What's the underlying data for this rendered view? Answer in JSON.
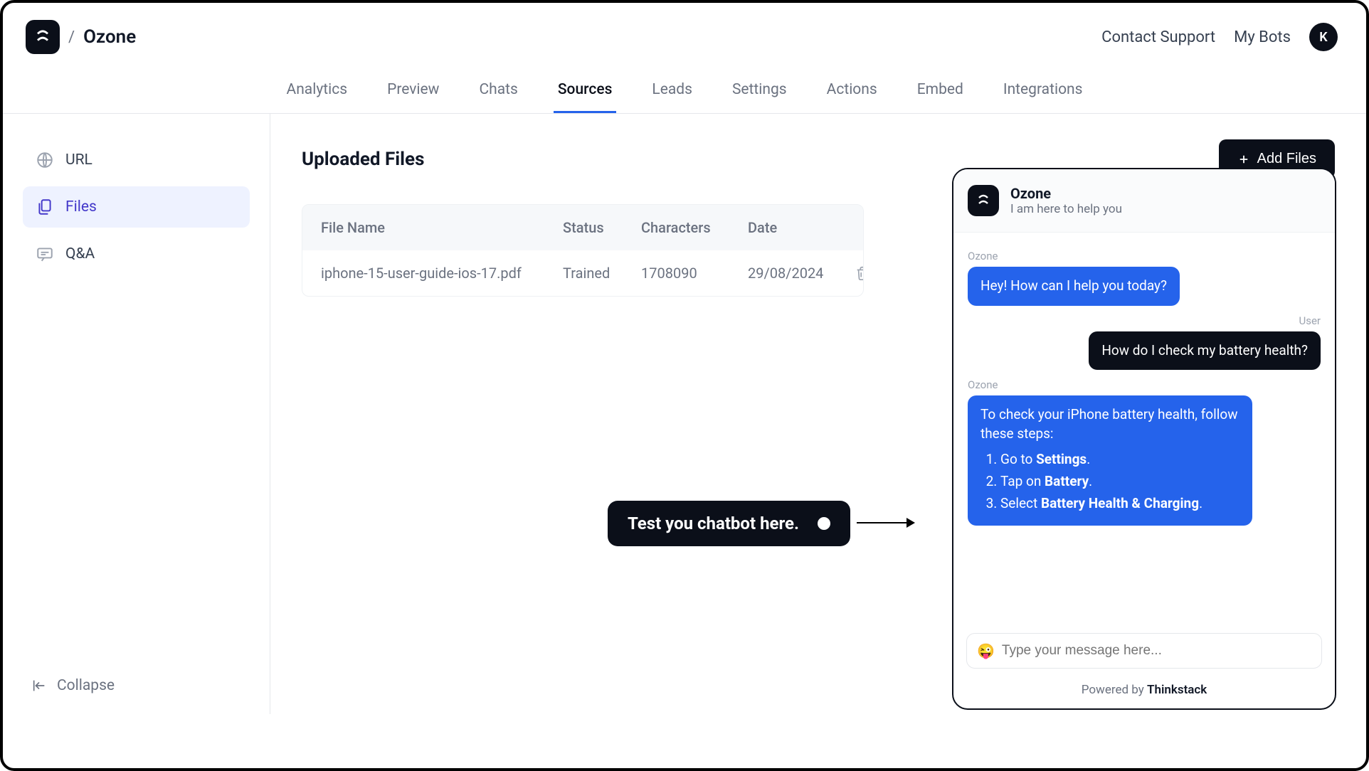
{
  "breadcrumb": {
    "title": "Ozone",
    "sep": "/"
  },
  "header_links": {
    "support": "Contact Support",
    "mybots": "My Bots",
    "avatar": "K"
  },
  "tabs": [
    {
      "label": "Analytics"
    },
    {
      "label": "Preview"
    },
    {
      "label": "Chats"
    },
    {
      "label": "Sources"
    },
    {
      "label": "Leads"
    },
    {
      "label": "Settings"
    },
    {
      "label": "Actions"
    },
    {
      "label": "Embed"
    },
    {
      "label": "Integrations"
    }
  ],
  "active_tab_index": 3,
  "sidebar": {
    "items": [
      {
        "label": "URL"
      },
      {
        "label": "Files"
      },
      {
        "label": "Q&A"
      }
    ],
    "active_index": 1,
    "collapse": "Collapse"
  },
  "main": {
    "title": "Uploaded Files",
    "add_label": "Add Files",
    "columns": {
      "name": "File Name",
      "status": "Status",
      "chars": "Characters",
      "date": "Date"
    },
    "rows": [
      {
        "name": "iphone-15-user-guide-ios-17.pdf",
        "status": "Trained",
        "chars": "1708090",
        "date": "29/08/2024"
      }
    ]
  },
  "callout": {
    "text": "Test you chatbot here."
  },
  "chat": {
    "header": {
      "title": "Ozone",
      "subtitle": "I am here to help you"
    },
    "messages": {
      "s0": "Ozone",
      "m0": "Hey! How can I help you today?",
      "s1": "User",
      "m1": "How do I check my battery health?",
      "s2": "Ozone",
      "m2_intro": "To check your iPhone battery health, follow these steps:",
      "m2_step1_a": "Go to ",
      "m2_step1_b": "Settings",
      "m2_step1_c": ".",
      "m2_step2_a": "Tap on ",
      "m2_step2_b": "Battery",
      "m2_step2_c": ".",
      "m2_step3_a": "Select ",
      "m2_step3_b": "Battery Health & Charging",
      "m2_step3_c": "."
    },
    "input_placeholder": "Type your message here...",
    "emoji": "😜",
    "powered_prefix": "Powered by ",
    "powered_brand": "Thinkstack"
  }
}
